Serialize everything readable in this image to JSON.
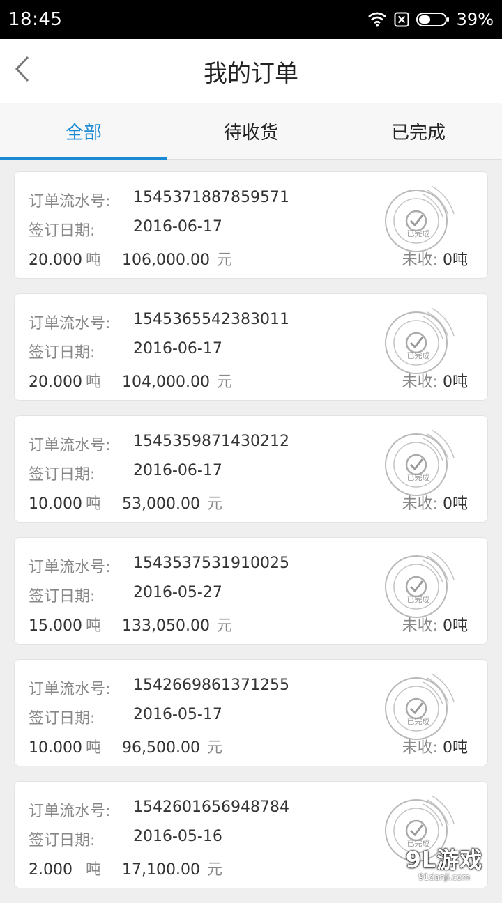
{
  "status_bar": {
    "time": "18:45",
    "battery": "39%"
  },
  "header": {
    "title": "我的订单"
  },
  "tabs": [
    {
      "label": "全部",
      "active": true
    },
    {
      "label": "待收货",
      "active": false
    },
    {
      "label": "已完成",
      "active": false
    }
  ],
  "labels": {
    "serial": "订单流水号:",
    "date": "签订日期:",
    "ton_unit": "吨",
    "yuan_unit": "元",
    "remain": "未收:",
    "stamp_text": "已完成"
  },
  "orders": [
    {
      "serial": "1545371887859571",
      "date": "2016-06-17",
      "tons": "20.000",
      "amount": "106,000.00",
      "remain": "0吨"
    },
    {
      "serial": "1545365542383011",
      "date": "2016-06-17",
      "tons": "20.000",
      "amount": "104,000.00",
      "remain": "0吨"
    },
    {
      "serial": "1545359871430212",
      "date": "2016-06-17",
      "tons": "10.000",
      "amount": "53,000.00",
      "remain": "0吨"
    },
    {
      "serial": "1543537531910025",
      "date": "2016-05-27",
      "tons": "15.000",
      "amount": "133,050.00",
      "remain": "0吨"
    },
    {
      "serial": "1542669861371255",
      "date": "2016-05-17",
      "tons": "10.000",
      "amount": "96,500.00",
      "remain": "0吨"
    },
    {
      "serial": "1542601656948784",
      "date": "2016-05-16",
      "tons": "2.000",
      "amount": "17,100.00",
      "remain": ""
    }
  ],
  "watermark": {
    "main": "9L游戏",
    "sub": "91danji.com"
  }
}
